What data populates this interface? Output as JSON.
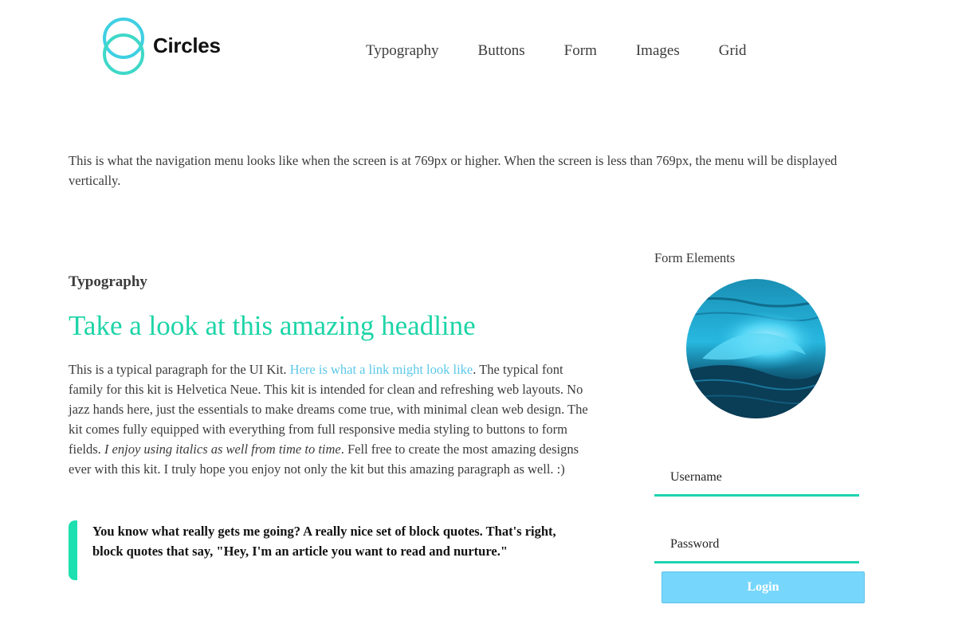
{
  "brand": {
    "name": "Circles",
    "ring_color": "#3fcfe3"
  },
  "nav": {
    "items": [
      "Typography",
      "Buttons",
      "Form",
      "Images",
      "Grid"
    ]
  },
  "intro": {
    "text": "This is what the navigation menu looks like when the screen is at 769px or higher. When the screen is less than 769px, the menu will be displayed vertically."
  },
  "typography": {
    "label": "Typography",
    "headline": "Take a look at this amazing headline",
    "paragraph": {
      "part1": "This is a typical paragraph for the UI Kit. ",
      "link": "Here is what a link might look like",
      "part2": ". The typical font family for this kit is Helvetica Neue. This kit is intended for clean and refreshing web layouts. No jazz hands here, just the essentials to make dreams come true, with minimal clean web design. The kit comes fully equipped with everything from full responsive media styling to buttons to form fields. ",
      "italic": "I enjoy using italics as well from time to time",
      "part3": ". Fell free to create the most amazing designs ever with this kit. I truly hope you enjoy not only the kit but this amazing paragraph as well. :)"
    },
    "quote": "You know what really gets me going? A really nice set of block quotes. That's right, block quotes that say, \"Hey, I'm an article you want to read and nurture.\""
  },
  "form": {
    "label": "Form Elements",
    "image": "wave-photo",
    "username_placeholder": "Username",
    "password_placeholder": "Password",
    "login_label": "Login"
  },
  "colors": {
    "accent": "#1dd4a7",
    "link": "#5bc8e8",
    "button": "#77d6fb"
  }
}
